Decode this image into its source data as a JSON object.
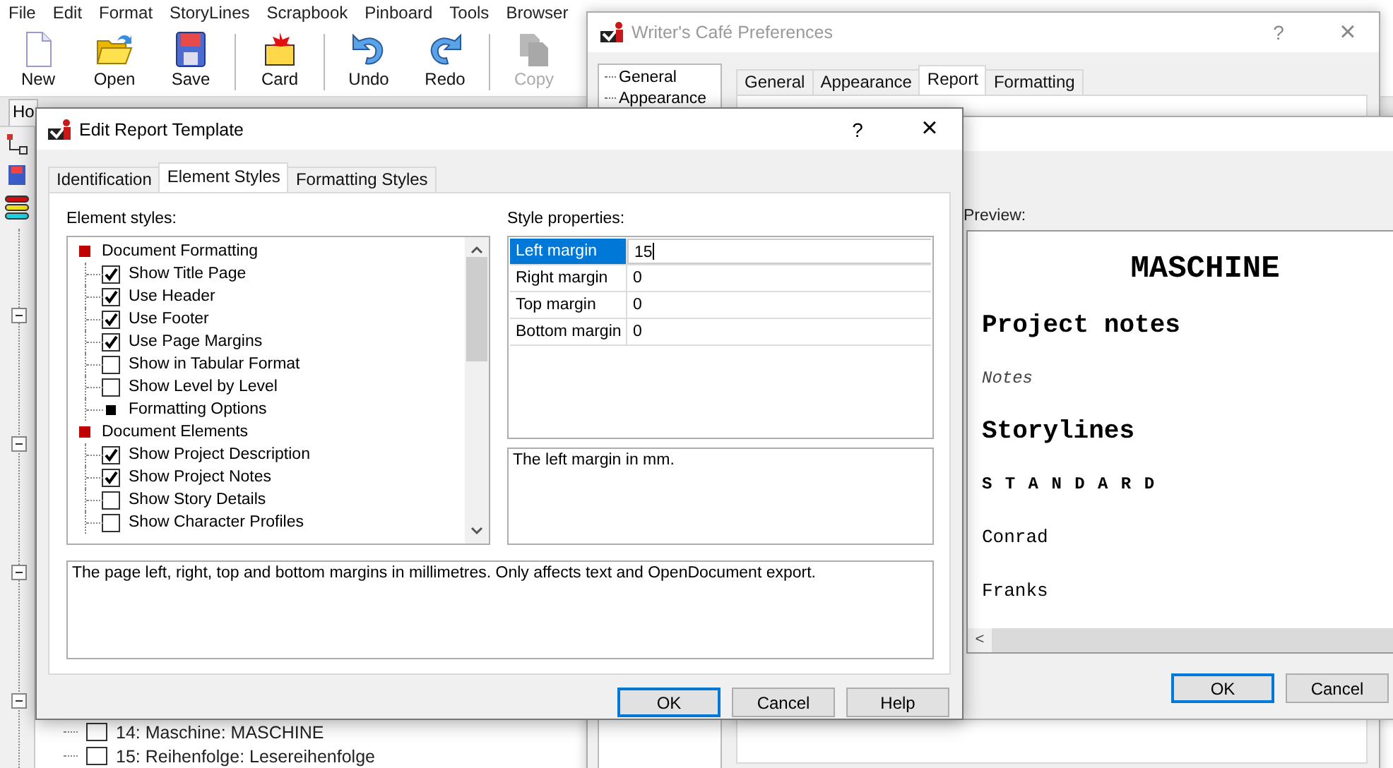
{
  "menu": [
    "File",
    "Edit",
    "Format",
    "StoryLines",
    "Scrapbook",
    "Pinboard",
    "Tools",
    "Browser"
  ],
  "toolbar": [
    {
      "kind": "new",
      "label": "New",
      "disabled": false
    },
    {
      "kind": "open",
      "label": "Open",
      "disabled": false
    },
    {
      "kind": "save",
      "label": "Save",
      "disabled": false
    },
    {
      "kind": "separator"
    },
    {
      "kind": "card",
      "label": "Card",
      "disabled": false
    },
    {
      "kind": "separator"
    },
    {
      "kind": "undo",
      "label": "Undo",
      "disabled": false
    },
    {
      "kind": "redo",
      "label": "Redo",
      "disabled": false
    },
    {
      "kind": "separator"
    },
    {
      "kind": "copy",
      "label": "Copy",
      "disabled": true
    }
  ],
  "document_tabs": [
    "Ho"
  ],
  "project_tree": [
    "14: Maschine: MASCHINE",
    "15: Reihenfolge: Lesereihenfolge"
  ],
  "preferences": {
    "title": "Writer's Café Preferences",
    "help": "?",
    "close": "×",
    "tree": [
      "General",
      "Appearance"
    ],
    "tabs": [
      {
        "label": "General",
        "selected": false
      },
      {
        "label": "Appearance",
        "selected": false
      },
      {
        "label": "Report",
        "selected": true
      },
      {
        "label": "Formatting",
        "selected": false
      }
    ]
  },
  "preview_window": {
    "label": "Preview:",
    "lines": [
      {
        "kind": "title",
        "text": "MASCHINE"
      },
      {
        "kind": "heading",
        "text": "Project notes"
      },
      {
        "kind": "note",
        "text": "Notes"
      },
      {
        "kind": "heading",
        "text": "Storylines"
      },
      {
        "kind": "spaced",
        "text": "S T A N D A R D"
      },
      {
        "kind": "body",
        "text": "Conrad"
      },
      {
        "kind": "body",
        "text": "Franks"
      }
    ],
    "scroll_left": "<",
    "buttons": [
      {
        "label": "OK",
        "default": true
      },
      {
        "label": "Cancel",
        "default": false
      }
    ]
  },
  "edit_dialog": {
    "title": "Edit Report Template",
    "help": "?",
    "close": "×",
    "tabs": [
      {
        "label": "Identification",
        "selected": false
      },
      {
        "label": "Element Styles",
        "selected": true
      },
      {
        "label": "Formatting Styles",
        "selected": false
      }
    ],
    "element_styles_label": "Element styles:",
    "element_styles": [
      {
        "kind": "category",
        "label": "Document Formatting",
        "children": [
          {
            "kind": "checkbox",
            "label": "Show Title Page",
            "checked": true
          },
          {
            "kind": "checkbox",
            "label": "Use Header",
            "checked": true
          },
          {
            "kind": "checkbox",
            "label": "Use Footer",
            "checked": true
          },
          {
            "kind": "checkbox",
            "label": "Use Page Margins",
            "checked": true
          },
          {
            "kind": "checkbox",
            "label": "Show in Tabular Format",
            "checked": false
          },
          {
            "kind": "checkbox",
            "label": "Show Level by Level",
            "checked": false
          },
          {
            "kind": "option",
            "label": "Formatting Options"
          }
        ]
      },
      {
        "kind": "category",
        "label": "Document Elements",
        "children": [
          {
            "kind": "checkbox",
            "label": "Show Project Description",
            "checked": true
          },
          {
            "kind": "checkbox",
            "label": "Show Project Notes",
            "checked": true
          },
          {
            "kind": "checkbox",
            "label": "Show Story Details",
            "checked": false
          },
          {
            "kind": "checkbox",
            "label": "Show Character Profiles",
            "checked": false
          }
        ]
      }
    ],
    "style_properties_label": "Style properties:",
    "properties": [
      {
        "name": "Left margin",
        "value": "15",
        "selected": true
      },
      {
        "name": "Right margin",
        "value": "0",
        "selected": false
      },
      {
        "name": "Top margin",
        "value": "0",
        "selected": false
      },
      {
        "name": "Bottom margin",
        "value": "0",
        "selected": false
      }
    ],
    "property_help": "The left margin in mm.",
    "element_help": "The page left, right, top and bottom margins in millimetres. Only affects text and OpenDocument export.",
    "buttons": [
      {
        "label": "OK",
        "default": true
      },
      {
        "label": "Cancel",
        "default": false
      },
      {
        "label": "Help",
        "default": false
      }
    ]
  }
}
